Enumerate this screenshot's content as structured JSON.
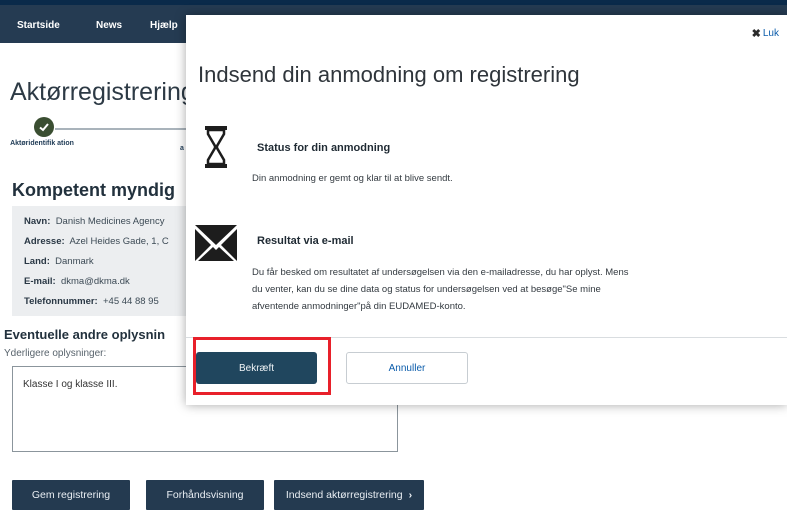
{
  "nav": {
    "items": [
      "Startside",
      "News",
      "Hjælp"
    ]
  },
  "background": {
    "page_title": "Aktørregistrering",
    "step1_label": "Aktøridentifik ation",
    "step2_stub": "a",
    "section_title": "Kompetent myndig",
    "info": {
      "navn_label": "Navn:",
      "navn_value": "Danish Medicines Agency",
      "adresse_label": "Adresse:",
      "adresse_value": "Azel Heides Gade, 1, C",
      "land_label": "Land:",
      "land_value": "Danmark",
      "email_label": "E-mail:",
      "email_value": "dkma@dkma.dk",
      "telefon_label": "Telefonnummer:",
      "telefon_value": "+45 44 88 95"
    },
    "other_title": "Eventuelle andre oplysnin",
    "field_label": "Yderligere oplysninger:",
    "textarea_value": "Klasse I og klasse III.",
    "buttons": {
      "save": "Gem registrering",
      "preview": "Forhåndsvisning",
      "submit": "Indsend aktørregistrering"
    }
  },
  "modal": {
    "close_label": "Luk",
    "title": "Indsend din anmodning om registrering",
    "status": {
      "icon": "hourglass-icon",
      "title": "Status for din anmodning",
      "text": "Din anmodning er gemt og klar til at blive sendt."
    },
    "result": {
      "icon": "envelope-icon",
      "title": "Resultat via e-mail",
      "text_line1": "Du får besked om resultatet af undersøgelsen via den e-mailadresse, du har oplyst. Mens",
      "text_line2": "du venter, kan du se dine data og status for undersøgelsen ved at besøge\"Se mine",
      "text_line3": "afventende anmodninger\"på din EUDAMED-konto."
    },
    "confirm_label": "Bekræft",
    "cancel_label": "Annuller"
  },
  "colors": {
    "navbar": "#253b52",
    "confirm": "#20465e",
    "highlight": "#e8202a",
    "link": "#0b5cab"
  }
}
